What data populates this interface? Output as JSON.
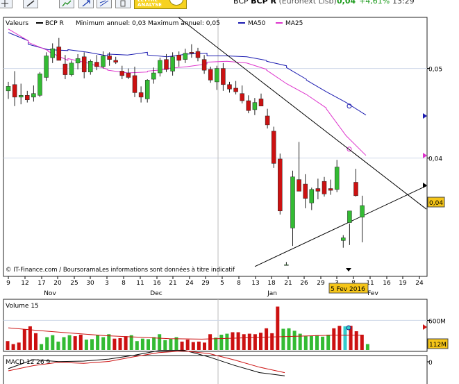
{
  "header": {
    "symbol_short": "BCP",
    "symbol": "BCP R",
    "market": "(Euronext Lisb)",
    "price": "0,04",
    "change": "+4,61%",
    "time": "13:29",
    "analyse_button": "LETTRE ANALYSE",
    "tool_icons": [
      "crosshair-icon",
      "pencil-icon",
      "trend-up-icon",
      "arrow-expand-icon",
      "fibonacci-icon",
      "trash-icon"
    ]
  },
  "colors": {
    "candle_up": "#33bb33",
    "candle_down": "#cc1111",
    "ma50": "#1a1ab0",
    "ma25": "#dd33cc",
    "volume_avg": "#cc1111",
    "price_tag": "#f5c518"
  },
  "chart_data": [
    {
      "type": "candlestick",
      "legend": [
        "Valeurs",
        "BCP R",
        "Minimum annuel: 0,03 Maximum annuel: 0,05",
        "MA50",
        "MA25"
      ],
      "source_note": "© IT-Finance.com / BoursoramaLes informations sont données à titre indicatif",
      "x_ticks": [
        "9",
        "12",
        "17",
        "20",
        "25",
        "30",
        "3",
        "8",
        "11",
        "16",
        "21",
        "24",
        "29",
        "5",
        "8",
        "13",
        "18",
        "21",
        "26",
        "29",
        "3",
        "8",
        "11",
        "16",
        "19",
        "24"
      ],
      "month_labels": [
        "Nov",
        "Dec",
        "Jan",
        "Fev"
      ],
      "y_ticks": [
        "0,05",
        "0,04"
      ],
      "y_range": [
        0.0268,
        0.0557
      ],
      "last_price_label": "0,04",
      "cursor_date_label": "5 Fev 2016",
      "ohlc": [
        [
          0.0475,
          0.0485,
          0.0466,
          0.048
        ],
        [
          0.0482,
          0.0497,
          0.0458,
          0.0468
        ],
        [
          0.0468,
          0.0483,
          0.046,
          0.047
        ],
        [
          0.047,
          0.0475,
          0.0462,
          0.0465
        ],
        [
          0.0468,
          0.0481,
          0.0463,
          0.0472
        ],
        [
          0.047,
          0.0496,
          0.0468,
          0.0494
        ],
        [
          0.049,
          0.0518,
          0.0486,
          0.0514
        ],
        [
          0.0512,
          0.0528,
          0.0506,
          0.0522
        ],
        [
          0.0524,
          0.0534,
          0.0509,
          0.0509
        ],
        [
          0.0505,
          0.0515,
          0.0488,
          0.0493
        ],
        [
          0.0493,
          0.0509,
          0.0491,
          0.0506
        ],
        [
          0.0506,
          0.0516,
          0.0499,
          0.0511
        ],
        [
          0.0513,
          0.0518,
          0.0489,
          0.0496
        ],
        [
          0.0496,
          0.051,
          0.0493,
          0.0508
        ],
        [
          0.0507,
          0.0515,
          0.0498,
          0.0502
        ],
        [
          0.0502,
          0.0519,
          0.05,
          0.0514
        ],
        [
          0.0514,
          0.0518,
          0.0503,
          0.051
        ],
        [
          0.0509,
          0.0513,
          0.0505,
          0.0507
        ],
        [
          0.0497,
          0.0503,
          0.0488,
          0.0492
        ],
        [
          0.0495,
          0.05,
          0.0488,
          0.049
        ],
        [
          0.0492,
          0.0502,
          0.0468,
          0.0473
        ],
        [
          0.0473,
          0.048,
          0.0462,
          0.0468
        ],
        [
          0.0466,
          0.0488,
          0.0462,
          0.0487
        ],
        [
          0.0488,
          0.0501,
          0.0483,
          0.0495
        ],
        [
          0.0495,
          0.0512,
          0.0491,
          0.0509
        ],
        [
          0.051,
          0.0516,
          0.0496,
          0.0499
        ],
        [
          0.0497,
          0.0518,
          0.0492,
          0.0513
        ],
        [
          0.0515,
          0.0519,
          0.0502,
          0.0509
        ],
        [
          0.051,
          0.0522,
          0.0506,
          0.0517
        ],
        [
          0.0518,
          0.0527,
          0.0512,
          0.0517
        ],
        [
          0.0519,
          0.0523,
          0.0508,
          0.0512
        ],
        [
          0.051,
          0.0515,
          0.0494,
          0.0498
        ],
        [
          0.0499,
          0.0502,
          0.0484,
          0.0487
        ],
        [
          0.0485,
          0.0503,
          0.0476,
          0.05
        ],
        [
          0.05,
          0.0506,
          0.0475,
          0.0482
        ],
        [
          0.0482,
          0.0485,
          0.0473,
          0.0477
        ],
        [
          0.0478,
          0.0486,
          0.0471,
          0.0474
        ],
        [
          0.0472,
          0.0481,
          0.0461,
          0.0464
        ],
        [
          0.0464,
          0.047,
          0.045,
          0.0453
        ],
        [
          0.0454,
          0.0467,
          0.0448,
          0.0462
        ],
        [
          0.0466,
          0.0472,
          0.0458,
          0.0458
        ],
        [
          0.0447,
          0.0455,
          0.0433,
          0.0437
        ],
        [
          0.043,
          0.0435,
          0.0389,
          0.0394
        ],
        [
          0.0399,
          0.0405,
          0.0337,
          0.0341
        ],
        [
          0.0281,
          0.0284,
          0.028,
          0.0281
        ],
        [
          0.0322,
          0.0386,
          0.0302,
          0.0379
        ],
        [
          0.0376,
          0.0418,
          0.0364,
          0.0363
        ],
        [
          0.0371,
          0.0382,
          0.0344,
          0.0355
        ],
        [
          0.035,
          0.0367,
          0.0342,
          0.0365
        ],
        [
          0.0366,
          0.0377,
          0.0354,
          0.0363
        ],
        [
          0.0374,
          0.0379,
          0.0357,
          0.036
        ],
        [
          0.0366,
          0.0376,
          0.0359,
          0.0364
        ],
        [
          0.0365,
          0.0398,
          0.0362,
          0.039
        ],
        [
          0.0308,
          0.0314,
          0.03,
          0.0311
        ],
        [
          0.0328,
          0.0327,
          0.0303,
          0.0341
        ],
        [
          0.0373,
          0.0388,
          0.0357,
          0.0358
        ],
        [
          0.0334,
          0.0358,
          0.0306,
          0.0347
        ]
      ],
      "ma50": [
        [
          0.054,
          0.0531
        ],
        [
          0.0527,
          0.0521
        ],
        [
          0.0521,
          0.052
        ],
        [
          0.0521,
          0.0518
        ],
        [
          0.0518,
          0.0514
        ],
        [
          0.0516,
          0.0515
        ],
        [
          0.0515,
          0.0518
        ],
        [
          0.0515,
          0.0513
        ],
        [
          0.0513,
          0.0516
        ],
        [
          0.0516,
          0.0517
        ],
        [
          0.0514,
          0.0514
        ],
        [
          0.0514,
          0.0513
        ],
        [
          0.0513,
          0.0509
        ],
        [
          0.0508,
          0.0503
        ],
        [
          0.0501,
          0.0488
        ],
        [
          0.0487,
          0.0474
        ],
        [
          0.0474,
          0.0462
        ],
        [
          0.0462,
          0.0448
        ]
      ],
      "ma25": [
        [
          0.0544,
          0.0531
        ],
        [
          0.0529,
          0.052
        ],
        [
          0.0519,
          0.0509
        ],
        [
          0.0511,
          0.0506
        ],
        [
          0.0506,
          0.0499
        ],
        [
          0.0498,
          0.0495
        ],
        [
          0.0495,
          0.0496
        ],
        [
          0.0497,
          0.0499
        ],
        [
          0.05,
          0.0502
        ],
        [
          0.0502,
          0.0505
        ],
        [
          0.0507,
          0.0508
        ],
        [
          0.0508,
          0.0506
        ],
        [
          0.0506,
          0.0499
        ],
        [
          0.0498,
          0.0483
        ],
        [
          0.0483,
          0.0471
        ],
        [
          0.0471,
          0.0456
        ],
        [
          0.0455,
          0.0425
        ],
        [
          0.0425,
          0.0403
        ]
      ],
      "trendlines": [
        {
          "from": [
            0.0557,
            0.0557
          ],
          "to": [
            0.0343,
            0.0343
          ]
        },
        {
          "from": [
            0.0279,
            0.0279
          ],
          "to": [
            0.0369,
            0.0369
          ]
        }
      ]
    },
    {
      "type": "bar",
      "title": "Volume 15",
      "y_ticks": [
        "600M"
      ],
      "last_value_label": "112M",
      "volumes": [
        [
          180,
          0
        ],
        [
          120,
          0
        ],
        [
          150,
          0
        ],
        [
          420,
          0
        ],
        [
          480,
          0
        ],
        [
          340,
          0
        ],
        [
          120,
          1
        ],
        [
          260,
          1
        ],
        [
          300,
          1
        ],
        [
          170,
          1
        ],
        [
          260,
          1
        ],
        [
          300,
          1
        ],
        [
          280,
          0
        ],
        [
          310,
          0
        ],
        [
          210,
          1
        ],
        [
          220,
          1
        ],
        [
          300,
          1
        ],
        [
          260,
          1
        ],
        [
          320,
          1
        ],
        [
          230,
          0
        ],
        [
          240,
          0
        ],
        [
          280,
          0
        ],
        [
          300,
          1
        ],
        [
          180,
          1
        ],
        [
          230,
          1
        ],
        [
          220,
          1
        ],
        [
          260,
          1
        ],
        [
          320,
          1
        ],
        [
          200,
          1
        ],
        [
          230,
          1
        ],
        [
          260,
          1
        ],
        [
          170,
          0
        ],
        [
          210,
          0
        ],
        [
          160,
          0
        ],
        [
          170,
          0
        ],
        [
          150,
          0
        ],
        [
          320,
          0
        ],
        [
          250,
          1
        ],
        [
          310,
          1
        ],
        [
          330,
          1
        ],
        [
          360,
          0
        ],
        [
          360,
          0
        ],
        [
          320,
          0
        ],
        [
          330,
          0
        ],
        [
          320,
          0
        ],
        [
          350,
          0
        ],
        [
          440,
          0
        ],
        [
          340,
          0
        ],
        [
          880,
          0
        ],
        [
          430,
          1
        ],
        [
          440,
          1
        ],
        [
          390,
          1
        ],
        [
          330,
          1
        ],
        [
          280,
          1
        ],
        [
          290,
          1
        ],
        [
          300,
          1
        ],
        [
          270,
          1
        ],
        [
          310,
          1
        ],
        [
          440,
          0
        ],
        [
          490,
          0
        ],
        [
          480,
          2
        ],
        [
          490,
          0
        ],
        [
          380,
          0
        ],
        [
          310,
          0
        ],
        [
          120,
          1
        ]
      ],
      "avg_line": [
        0.0045,
        0.0039,
        0.0034,
        0.0029,
        0.0026,
        0.0023,
        0.0022,
        0.0024,
        0.0026,
        0.0028,
        0.003,
        0.003
      ]
    },
    {
      "type": "line",
      "title": "MACD 12 26 9",
      "y_ticks": [
        "0"
      ],
      "macd": [
        -0.0038,
        0.0012,
        0.0001,
        0.0004,
        0.0015,
        0.0036,
        0.0062,
        0.0064,
        0.0026,
        -0.002,
        -0.006,
        -0.0078
      ],
      "signal": [
        -0.005,
        -0.0021,
        -0.0003,
        -0.0009,
        0.0002,
        0.0028,
        0.0051,
        0.006,
        0.0045,
        0.001,
        -0.003,
        -0.006
      ]
    }
  ]
}
